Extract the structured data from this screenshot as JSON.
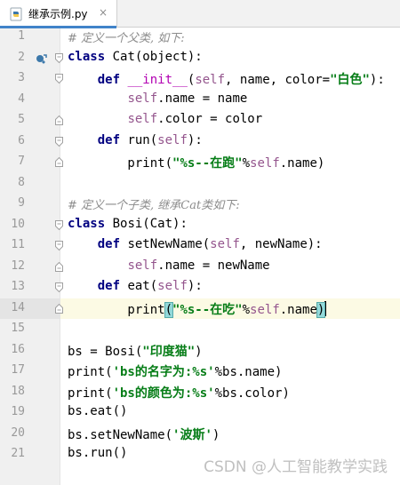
{
  "tab": {
    "filename": "继承示例.py",
    "close": "×"
  },
  "lines": [
    {
      "n": "1",
      "parts": [
        [
          "cmt",
          "# 定义一个父类, 如下:"
        ]
      ]
    },
    {
      "n": "2",
      "parts": [
        [
          "kw",
          "class"
        ],
        [
          "",
          " Cat(object):"
        ]
      ]
    },
    {
      "n": "3",
      "parts": [
        [
          "",
          "    "
        ],
        [
          "kw",
          "def"
        ],
        [
          "",
          " "
        ],
        [
          "magic",
          "__init__"
        ],
        [
          "",
          "("
        ],
        [
          "self",
          "self"
        ],
        [
          "",
          ", name, color="
        ],
        [
          "str",
          "\"白色\""
        ],
        [
          "",
          "):"
        ]
      ]
    },
    {
      "n": "4",
      "parts": [
        [
          "",
          "        "
        ],
        [
          "self",
          "self"
        ],
        [
          "",
          ".name = name"
        ]
      ]
    },
    {
      "n": "5",
      "parts": [
        [
          "",
          "        "
        ],
        [
          "self",
          "self"
        ],
        [
          "",
          ".color = color"
        ]
      ]
    },
    {
      "n": "6",
      "parts": [
        [
          "",
          "    "
        ],
        [
          "kw",
          "def"
        ],
        [
          "",
          " run("
        ],
        [
          "self",
          "self"
        ],
        [
          "",
          "):"
        ]
      ]
    },
    {
      "n": "7",
      "parts": [
        [
          "",
          "        print("
        ],
        [
          "str",
          "\"%s--在跑\""
        ],
        [
          "",
          "%"
        ],
        [
          "self",
          "self"
        ],
        [
          "",
          ".name)"
        ]
      ]
    },
    {
      "n": "8",
      "parts": []
    },
    {
      "n": "9",
      "parts": [
        [
          "cmt",
          "# 定义一个子类, 继承Cat类如下:"
        ]
      ]
    },
    {
      "n": "10",
      "parts": [
        [
          "kw",
          "class"
        ],
        [
          "",
          " Bosi(Cat):"
        ]
      ]
    },
    {
      "n": "11",
      "parts": [
        [
          "",
          "    "
        ],
        [
          "kw",
          "def"
        ],
        [
          "",
          " setNewName("
        ],
        [
          "self",
          "self"
        ],
        [
          "",
          ", newName):"
        ]
      ]
    },
    {
      "n": "12",
      "parts": [
        [
          "",
          "        "
        ],
        [
          "self",
          "self"
        ],
        [
          "",
          ".name = newName"
        ]
      ]
    },
    {
      "n": "13",
      "parts": [
        [
          "",
          "    "
        ],
        [
          "kw",
          "def"
        ],
        [
          "",
          " eat("
        ],
        [
          "self",
          "self"
        ],
        [
          "",
          "):"
        ]
      ]
    },
    {
      "n": "14",
      "parts": [
        [
          "",
          "        print"
        ],
        [
          "paren",
          "("
        ],
        [
          "str",
          "\"%s--在吃\""
        ],
        [
          "",
          "%"
        ],
        [
          "self",
          "self"
        ],
        [
          "",
          ".name"
        ],
        [
          "paren",
          ")"
        ],
        [
          "caret",
          ""
        ]
      ]
    },
    {
      "n": "15",
      "parts": []
    },
    {
      "n": "16",
      "parts": [
        [
          "",
          "bs = Bosi("
        ],
        [
          "str",
          "\"印度猫\""
        ],
        [
          "",
          ")"
        ]
      ]
    },
    {
      "n": "17",
      "parts": [
        [
          "",
          "print("
        ],
        [
          "str",
          "'bs的名字为:%s'"
        ],
        [
          "",
          "%bs.name)"
        ]
      ]
    },
    {
      "n": "18",
      "parts": [
        [
          "",
          "print("
        ],
        [
          "str",
          "'bs的颜色为:%s'"
        ],
        [
          "",
          "%bs.color)"
        ]
      ]
    },
    {
      "n": "19",
      "parts": [
        [
          "",
          "bs.eat()"
        ]
      ]
    },
    {
      "n": "20",
      "parts": [
        [
          "",
          "bs.setNewName("
        ],
        [
          "str",
          "'波斯'"
        ],
        [
          "",
          ")"
        ]
      ]
    },
    {
      "n": "21",
      "parts": [
        [
          "",
          "bs.run()"
        ]
      ]
    }
  ],
  "current_line": "14",
  "watermark": "CSDN @人工智能教学实践",
  "colors": {
    "keyword": "#000080",
    "self": "#94558d",
    "string": "#067d17",
    "comment": "#8c8c8c",
    "gutter": "#f0f0f0",
    "current_line": "#fcfae4"
  }
}
